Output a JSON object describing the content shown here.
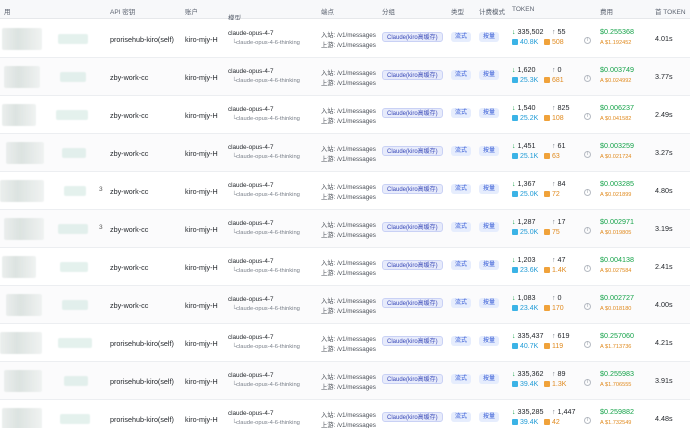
{
  "header": {
    "col_user": "用",
    "col_key": "API 密钥",
    "col_account": "账户",
    "col_model": "模型",
    "col_endpoint": "端点",
    "col_group": "分组",
    "col_type": "类型",
    "col_mode": "计费模式",
    "col_token": "TOKEN",
    "col_cost": "费用",
    "col_first_token": "首 TOKEN",
    "model_sort_icon": "chevron-down-icon"
  },
  "colors": {
    "input_arrow": "#16a34a",
    "cache_read": "#1f9bd6",
    "cache_write": "#e08a1e",
    "cost": "#16a34a",
    "badge_bg": "#e7ebfb",
    "badge_text": "#3a4ab8"
  },
  "rows": [
    {
      "lead": "",
      "key": "prorisehub-kiro(self)",
      "account": "kiro-mjy-H",
      "model": "claude-opus-4-7",
      "model_sub": "└claude-opus-4-6-thinking",
      "endpoint_in": "入站: /v1/messages",
      "endpoint_up": "上游: /v1/messages",
      "group": "Claude(kiro高缓存)",
      "type": "流式",
      "mode": "按量",
      "tok_in": "335,502",
      "tok_out": "55",
      "cache_read": "40.8K",
      "cache_write": "508",
      "cost": "$0.255368",
      "cost_sub": "A $1.192452",
      "first_token": "4.01s"
    },
    {
      "lead": "",
      "key": "zby-work-cc",
      "account": "kiro-mjy-H",
      "model": "claude-opus-4-7",
      "model_sub": "└claude-opus-4-6-thinking",
      "endpoint_in": "入站: /v1/messages",
      "endpoint_up": "上游: /v1/messages",
      "group": "Claude(kiro高缓存)",
      "type": "流式",
      "mode": "按量",
      "tok_in": "1,620",
      "tok_out": "0",
      "cache_read": "25.3K",
      "cache_write": "681",
      "cost": "$0.003749",
      "cost_sub": "A $0.024992",
      "first_token": "3.77s"
    },
    {
      "lead": "",
      "key": "zby-work-cc",
      "account": "kiro-mjy-H",
      "model": "claude-opus-4-7",
      "model_sub": "└claude-opus-4-6-thinking",
      "endpoint_in": "入站: /v1/messages",
      "endpoint_up": "上游: /v1/messages",
      "group": "Claude(kiro高缓存)",
      "type": "流式",
      "mode": "按量",
      "tok_in": "1,540",
      "tok_out": "825",
      "cache_read": "25.2K",
      "cache_write": "108",
      "cost": "$0.006237",
      "cost_sub": "A $0.041582",
      "first_token": "2.49s"
    },
    {
      "lead": "",
      "key": "zby-work-cc",
      "account": "kiro-mjy-H",
      "model": "claude-opus-4-7",
      "model_sub": "└claude-opus-4-6-thinking",
      "endpoint_in": "入站: /v1/messages",
      "endpoint_up": "上游: /v1/messages",
      "group": "Claude(kiro高缓存)",
      "type": "流式",
      "mode": "按量",
      "tok_in": "1,451",
      "tok_out": "61",
      "cache_read": "25.1K",
      "cache_write": "63",
      "cost": "$0.003259",
      "cost_sub": "A $0.021724",
      "first_token": "3.27s"
    },
    {
      "lead": "3",
      "key": "zby-work-cc",
      "account": "kiro-mjy-H",
      "model": "claude-opus-4-7",
      "model_sub": "└claude-opus-4-6-thinking",
      "endpoint_in": "入站: /v1/messages",
      "endpoint_up": "上游: /v1/messages",
      "group": "Claude(kiro高缓存)",
      "type": "流式",
      "mode": "按量",
      "tok_in": "1,367",
      "tok_out": "84",
      "cache_read": "25.0K",
      "cache_write": "72",
      "cost": "$0.003285",
      "cost_sub": "A $0.021899",
      "first_token": "4.80s"
    },
    {
      "lead": "3",
      "key": "zby-work-cc",
      "account": "kiro-mjy-H",
      "model": "claude-opus-4-7",
      "model_sub": "└claude-opus-4-6-thinking",
      "endpoint_in": "入站: /v1/messages",
      "endpoint_up": "上游: /v1/messages",
      "group": "Claude(kiro高缓存)",
      "type": "流式",
      "mode": "按量",
      "tok_in": "1,287",
      "tok_out": "17",
      "cache_read": "25.0K",
      "cache_write": "75",
      "cost": "$0.002971",
      "cost_sub": "A $0.019805",
      "first_token": "3.19s"
    },
    {
      "lead": "",
      "key": "zby-work-cc",
      "account": "kiro-mjy-H",
      "model": "claude-opus-4-7",
      "model_sub": "└claude-opus-4-6-thinking",
      "endpoint_in": "入站: /v1/messages",
      "endpoint_up": "上游: /v1/messages",
      "group": "Claude(kiro高缓存)",
      "type": "流式",
      "mode": "按量",
      "tok_in": "1,203",
      "tok_out": "47",
      "cache_read": "23.6K",
      "cache_write": "1.4K",
      "cost": "$0.004138",
      "cost_sub": "A $0.027584",
      "first_token": "2.41s"
    },
    {
      "lead": "",
      "key": "zby-work-cc",
      "account": "kiro-mjy-H",
      "model": "claude-opus-4-7",
      "model_sub": "└claude-opus-4-6-thinking",
      "endpoint_in": "入站: /v1/messages",
      "endpoint_up": "上游: /v1/messages",
      "group": "Claude(kiro高缓存)",
      "type": "流式",
      "mode": "按量",
      "tok_in": "1,083",
      "tok_out": "0",
      "cache_read": "23.4K",
      "cache_write": "170",
      "cost": "$0.002727",
      "cost_sub": "A $0.018180",
      "first_token": "4.00s"
    },
    {
      "lead": "",
      "key": "prorisehub-kiro(self)",
      "account": "kiro-mjy-H",
      "model": "claude-opus-4-7",
      "model_sub": "└claude-opus-4-6-thinking",
      "endpoint_in": "入站: /v1/messages",
      "endpoint_up": "上游: /v1/messages",
      "group": "Claude(kiro高缓存)",
      "type": "流式",
      "mode": "按量",
      "tok_in": "335,437",
      "tok_out": "619",
      "cache_read": "40.7K",
      "cache_write": "119",
      "cost": "$0.257060",
      "cost_sub": "A $1.713736",
      "first_token": "4.21s"
    },
    {
      "lead": "",
      "key": "prorisehub-kiro(self)",
      "account": "kiro-mjy-H",
      "model": "claude-opus-4-7",
      "model_sub": "└claude-opus-4-6-thinking",
      "endpoint_in": "入站: /v1/messages",
      "endpoint_up": "上游: /v1/messages",
      "group": "Claude(kiro高缓存)",
      "type": "流式",
      "mode": "按量",
      "tok_in": "335,362",
      "tok_out": "89",
      "cache_read": "39.4K",
      "cache_write": "1.3K",
      "cost": "$0.255983",
      "cost_sub": "A $1.706555",
      "first_token": "3.91s"
    },
    {
      "lead": "",
      "key": "prorisehub-kiro(self)",
      "account": "kiro-mjy-H",
      "model": "claude-opus-4-7",
      "model_sub": "└claude-opus-4-6-thinking",
      "endpoint_in": "入站: /v1/messages",
      "endpoint_up": "上游: /v1/messages",
      "group": "Claude(kiro高缓存)",
      "type": "流式",
      "mode": "按量",
      "tok_in": "335,285",
      "tok_out": "1,447",
      "cache_read": "39.4K",
      "cache_write": "42",
      "cost": "$0.259882",
      "cost_sub": "A $1.732549",
      "first_token": "4.48s"
    }
  ]
}
